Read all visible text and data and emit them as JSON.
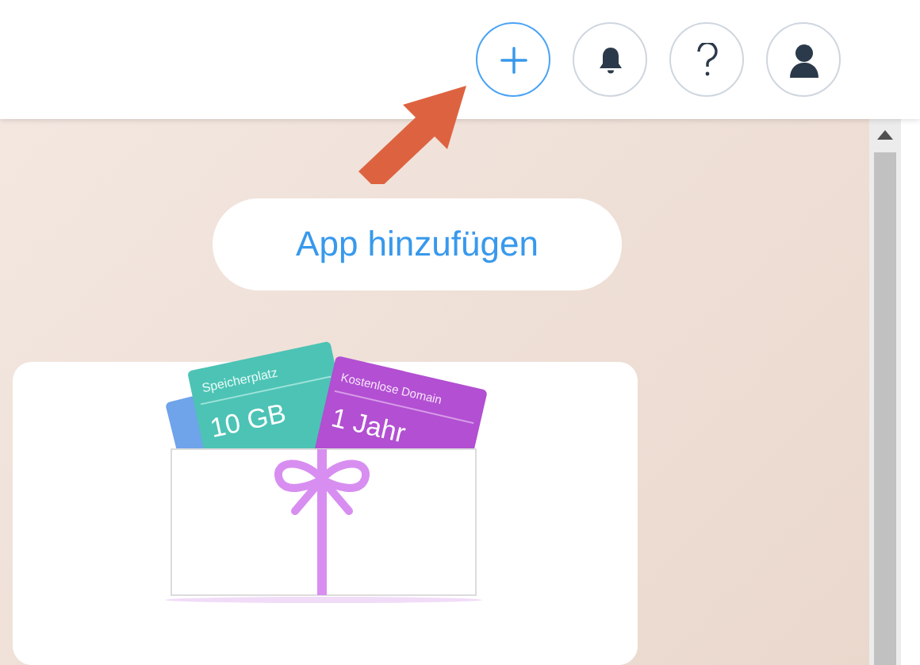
{
  "header": {
    "buttons": [
      {
        "kind": "add",
        "selected": true
      },
      {
        "kind": "notifications",
        "selected": false
      },
      {
        "kind": "help",
        "selected": false
      },
      {
        "kind": "account",
        "selected": false
      }
    ]
  },
  "add_app_button": {
    "label": "App hinzufügen"
  },
  "promo_card": {
    "tickets": [
      {
        "title": "Speicherplatz",
        "value": "10 GB"
      },
      {
        "title": "Kostenlose Domain",
        "value": "1 Jahr"
      }
    ]
  }
}
